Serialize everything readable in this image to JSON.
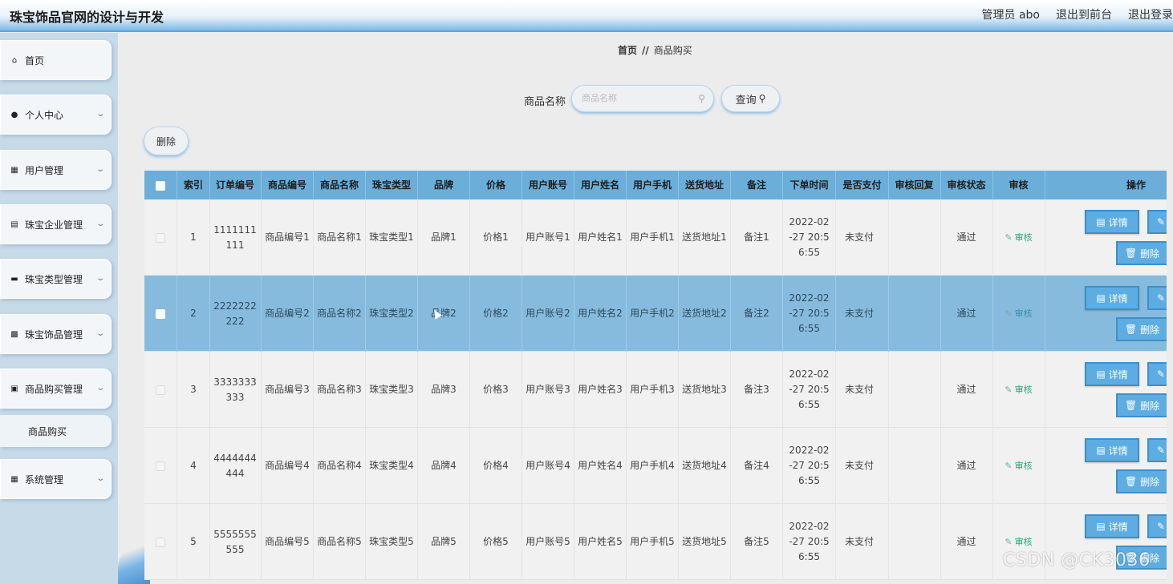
{
  "header": {
    "title": "珠宝饰品官网的设计与开发",
    "admin": "管理员 abo",
    "to_front": "退出到前台",
    "logout": "退出登录"
  },
  "sidebar": {
    "items": [
      {
        "label": "首页",
        "icon": "home-icon"
      },
      {
        "label": "个人中心",
        "icon": "user-icon"
      },
      {
        "label": "用户管理",
        "icon": "grid-icon"
      },
      {
        "label": "珠宝企业管理",
        "icon": "clipboard-icon"
      },
      {
        "label": "珠宝类型管理",
        "icon": "monitor-icon"
      },
      {
        "label": "珠宝饰品管理",
        "icon": "chat-icon"
      },
      {
        "label": "商品购买管理",
        "icon": "cart-icon"
      },
      {
        "label": "系统管理",
        "icon": "grid-icon"
      }
    ],
    "submenu": "商品购买"
  },
  "breadcrumb": {
    "home": "首页",
    "sep": "//",
    "current": "商品购买"
  },
  "search": {
    "label": "商品名称",
    "placeholder": "商品名称",
    "button": "查询"
  },
  "actions": {
    "delete": "删除"
  },
  "table": {
    "headers": [
      "",
      "索引",
      "订单编号",
      "商品编号",
      "商品名称",
      "珠宝类型",
      "品牌",
      "价格",
      "用户账号",
      "用户姓名",
      "用户手机",
      "送货地址",
      "备注",
      "下单时间",
      "是否支付",
      "审核回复",
      "审核状态",
      "审核",
      "操作"
    ],
    "rows": [
      {
        "idx": "1",
        "order": "1111111111",
        "goods_no": "商品编号1",
        "goods_name": "商品名称1",
        "type": "珠宝类型1",
        "brand": "品牌1",
        "price": "价格1",
        "account": "用户账号1",
        "name": "用户姓名1",
        "phone": "用户手机1",
        "address": "送货地址1",
        "remark": "备注1",
        "time": "2022-02-27 20:56:55",
        "paid": "未支付",
        "reply": "",
        "status": "通过",
        "audit": "审核"
      },
      {
        "idx": "2",
        "order": "2222222222",
        "goods_no": "商品编号2",
        "goods_name": "商品名称2",
        "type": "珠宝类型2",
        "brand": "品牌2",
        "price": "价格2",
        "account": "用户账号2",
        "name": "用户姓名2",
        "phone": "用户手机2",
        "address": "送货地址2",
        "remark": "备注2",
        "time": "2022-02-27 20:56:55",
        "paid": "未支付",
        "reply": "",
        "status": "通过",
        "audit": "审核"
      },
      {
        "idx": "3",
        "order": "3333333333",
        "goods_no": "商品编号3",
        "goods_name": "商品名称3",
        "type": "珠宝类型3",
        "brand": "品牌3",
        "price": "价格3",
        "account": "用户账号3",
        "name": "用户姓名3",
        "phone": "用户手机3",
        "address": "送货地址3",
        "remark": "备注3",
        "time": "2022-02-27 20:56:55",
        "paid": "未支付",
        "reply": "",
        "status": "通过",
        "audit": "审核"
      },
      {
        "idx": "4",
        "order": "4444444444",
        "goods_no": "商品编号4",
        "goods_name": "商品名称4",
        "type": "珠宝类型4",
        "brand": "品牌4",
        "price": "价格4",
        "account": "用户账号4",
        "name": "用户姓名4",
        "phone": "用户手机4",
        "address": "送货地址4",
        "remark": "备注4",
        "time": "2022-02-27 20:56:55",
        "paid": "未支付",
        "reply": "",
        "status": "通过",
        "audit": "审核"
      },
      {
        "idx": "5",
        "order": "5555555555",
        "goods_no": "商品编号5",
        "goods_name": "商品名称5",
        "type": "珠宝类型5",
        "brand": "品牌5",
        "price": "价格5",
        "account": "用户账号5",
        "name": "用户姓名5",
        "phone": "用户手机5",
        "address": "送货地址5",
        "remark": "备注5",
        "time": "2022-02-27 20:56:55",
        "paid": "未支付",
        "reply": "",
        "status": "通过",
        "audit": "审核"
      }
    ],
    "selected_row": 2,
    "row_buttons": {
      "detail": "详情",
      "delete": "删除"
    }
  },
  "watermark": "CSDN @CK3036",
  "colors": {
    "accent": "#5dade2",
    "header_row": "#6aaed9",
    "selected_row": "#86bbdd",
    "audit_text": "#2aa87a"
  }
}
